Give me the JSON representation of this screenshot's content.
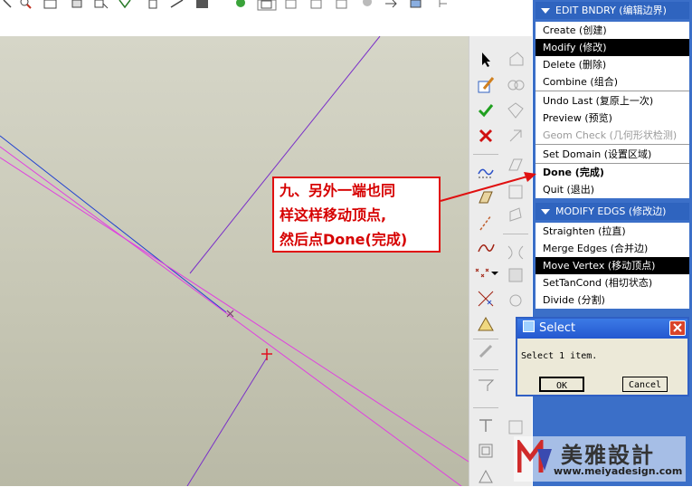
{
  "menu": {
    "edit_bndry": {
      "header": "EDIT BNDRY (编辑边界)",
      "items": [
        {
          "label": "Create (创建)",
          "state": "normal"
        },
        {
          "label": "Modify (修改)",
          "state": "selected"
        },
        {
          "label": "Delete (删除)",
          "state": "normal"
        },
        {
          "label": "Combine (组合)",
          "state": "normal"
        },
        {
          "label": "Undo Last (复原上一次)",
          "state": "normal"
        },
        {
          "label": "Preview (预览)",
          "state": "normal"
        },
        {
          "label": "Geom Check (几何形状检测)",
          "state": "disabled"
        },
        {
          "label": "Set Domain (设置区域)",
          "state": "normal"
        },
        {
          "label": "Done (完成)",
          "state": "bold"
        },
        {
          "label": "Quit (退出)",
          "state": "normal"
        }
      ]
    },
    "modify_edgs": {
      "header": "MODIFY EDGS (修改边)",
      "items": [
        {
          "label": "Straighten (拉直)",
          "state": "normal"
        },
        {
          "label": "Merge Edges (合并边)",
          "state": "normal"
        },
        {
          "label": "Move Vertex (移动顶点)",
          "state": "selected"
        },
        {
          "label": "SetTanCond (相切状态)",
          "state": "normal"
        },
        {
          "label": "Divide (分割)",
          "state": "normal"
        }
      ]
    }
  },
  "dialog": {
    "title": "Select",
    "message": "Select 1 item.",
    "ok_label": "OK",
    "cancel_label": "Cancel"
  },
  "annotation": {
    "lines": [
      "九、另外一端也同",
      "样这样移动顶点,",
      "然后点Done(完成)"
    ]
  },
  "watermark": {
    "brand": "美雅設計",
    "url": "www.meiyadesign.com"
  },
  "colors": {
    "menu_blue": "#3b6fc8",
    "selected_bg": "#000000",
    "annotation_red": "#e01010",
    "curve_magenta": "#e040e0",
    "curve_purple": "#7a30c8",
    "curve_blue": "#2040d0"
  },
  "icons": {
    "toolbar": [
      "select-arrow-icon",
      "sketch-edit-icon",
      "accept-check-icon",
      "cancel-x-icon",
      "curve-tool-icon",
      "surface-tool-icon",
      "line-tool-icon",
      "spline-icon",
      "points-icon",
      "datum-points-icon",
      "analysis-icon",
      "pen-tool-icon"
    ]
  }
}
